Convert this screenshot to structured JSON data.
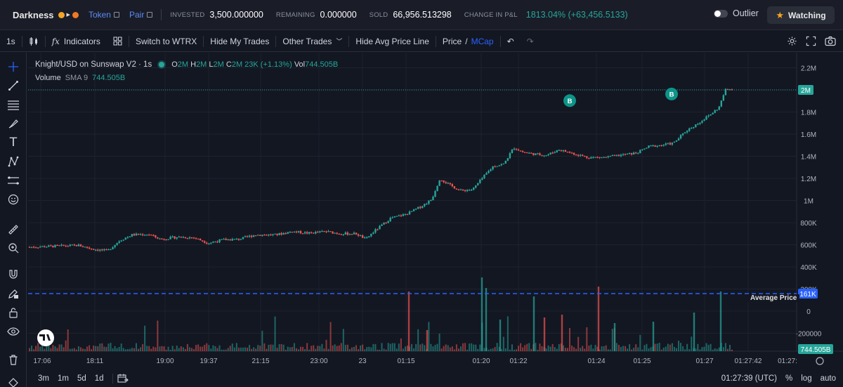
{
  "header": {
    "token_name": "Darkness",
    "token_label": "Token",
    "pair_label": "Pair",
    "invested_label": "INVESTED",
    "invested_value": "3,500.000000",
    "remaining_label": "REMAINING",
    "remaining_value": "0.000000",
    "sold_label": "SOLD",
    "sold_value": "66,956.513298",
    "pnl_label": "CHANGE IN P&L",
    "pnl_value": "1813.04% (+63,456.5133)",
    "outlier_label": "Outlier",
    "watching_label": "Watching"
  },
  "toolbar": {
    "interval": "1s",
    "indicators": "Indicators",
    "switch": "Switch to WTRX",
    "hide_trades": "Hide My Trades",
    "other_trades": "Other Trades",
    "hide_avg": "Hide Avg Price Line",
    "price": "Price",
    "slash": "/",
    "mcap": "MCap"
  },
  "legend": {
    "symbol": "Knight/USD on Sunswap V2 · 1s",
    "o_label": "O",
    "o_val": "2M",
    "h_label": "H",
    "h_val": "2M",
    "l_label": "L",
    "l_val": "2M",
    "c_label": "C",
    "c_val": "2M",
    "change": "23K (+1.13%)",
    "vol_label": "Vol",
    "vol_val": "744.505B",
    "volume_label": "Volume",
    "sma_label": "SMA 9",
    "sma_val": "744.505B"
  },
  "avg_price_label": "Average Price",
  "chart_data": {
    "type": "candlestick",
    "y_axis_ticks": [
      "2.2M",
      "2M",
      "1.8M",
      "1.6M",
      "1.4M",
      "1.2M",
      "1M",
      "800K",
      "600K",
      "400K",
      "200K",
      "0",
      "-200000"
    ],
    "y_ticks_values": [
      2200000,
      2000000,
      1800000,
      1600000,
      1400000,
      1200000,
      1000000,
      800000,
      600000,
      400000,
      200000,
      0,
      -200000
    ],
    "x_axis_ticks": [
      "17:06",
      "18:11",
      "19:00",
      "19:37",
      "21:15",
      "23:00",
      "23",
      "01:15",
      "01:20",
      "01:22",
      "01:24",
      "01:25",
      "01:27",
      "01:27:42",
      "01:27:"
    ],
    "last_price_label": "2M",
    "last_price": 2000000,
    "average_price_label": "161K",
    "average_price": 161000,
    "volume_label": "744.505B",
    "trade_markers": [
      {
        "label": "B",
        "price": 1560000
      },
      {
        "label": "B",
        "price": 1620000
      }
    ],
    "price_path": [
      [
        0,
        580000
      ],
      [
        20,
        585000
      ],
      [
        40,
        590000
      ],
      [
        60,
        595000
      ],
      [
        78,
        560000
      ],
      [
        95,
        545000
      ],
      [
        110,
        640000
      ],
      [
        125,
        690000
      ],
      [
        145,
        695000
      ],
      [
        160,
        650000
      ],
      [
        180,
        670000
      ],
      [
        200,
        665000
      ],
      [
        218,
        615000
      ],
      [
        235,
        645000
      ],
      [
        255,
        650000
      ],
      [
        275,
        690000
      ],
      [
        300,
        690000
      ],
      [
        320,
        720000
      ],
      [
        340,
        705000
      ],
      [
        360,
        720000
      ],
      [
        380,
        700000
      ],
      [
        398,
        700000
      ],
      [
        410,
        650000
      ],
      [
        418,
        710000
      ],
      [
        440,
        840000
      ],
      [
        460,
        880000
      ],
      [
        478,
        950000
      ],
      [
        490,
        1010000
      ],
      [
        500,
        1200000
      ],
      [
        512,
        1140000
      ],
      [
        525,
        1090000
      ],
      [
        540,
        1100000
      ],
      [
        555,
        1230000
      ],
      [
        565,
        1310000
      ],
      [
        578,
        1330000
      ],
      [
        590,
        1480000
      ],
      [
        600,
        1440000
      ],
      [
        615,
        1420000
      ],
      [
        630,
        1410000
      ],
      [
        645,
        1460000
      ],
      [
        660,
        1430000
      ],
      [
        680,
        1390000
      ],
      [
        700,
        1390000
      ],
      [
        720,
        1410000
      ],
      [
        740,
        1430000
      ],
      [
        755,
        1490000
      ],
      [
        770,
        1500000
      ],
      [
        785,
        1520000
      ],
      [
        800,
        1630000
      ],
      [
        815,
        1700000
      ],
      [
        830,
        1780000
      ],
      [
        840,
        1840000
      ],
      [
        848,
        2000000
      ],
      [
        856,
        2010000
      ]
    ]
  },
  "bottom": {
    "ranges": [
      "3m",
      "1m",
      "5d",
      "1d"
    ],
    "time": "01:27:39 (UTC)",
    "pct": "%",
    "log": "log",
    "auto": "auto"
  },
  "colors": {
    "up": "#26a69a",
    "down": "#ef5350",
    "avg_line": "#2962ff",
    "background": "#131722"
  }
}
